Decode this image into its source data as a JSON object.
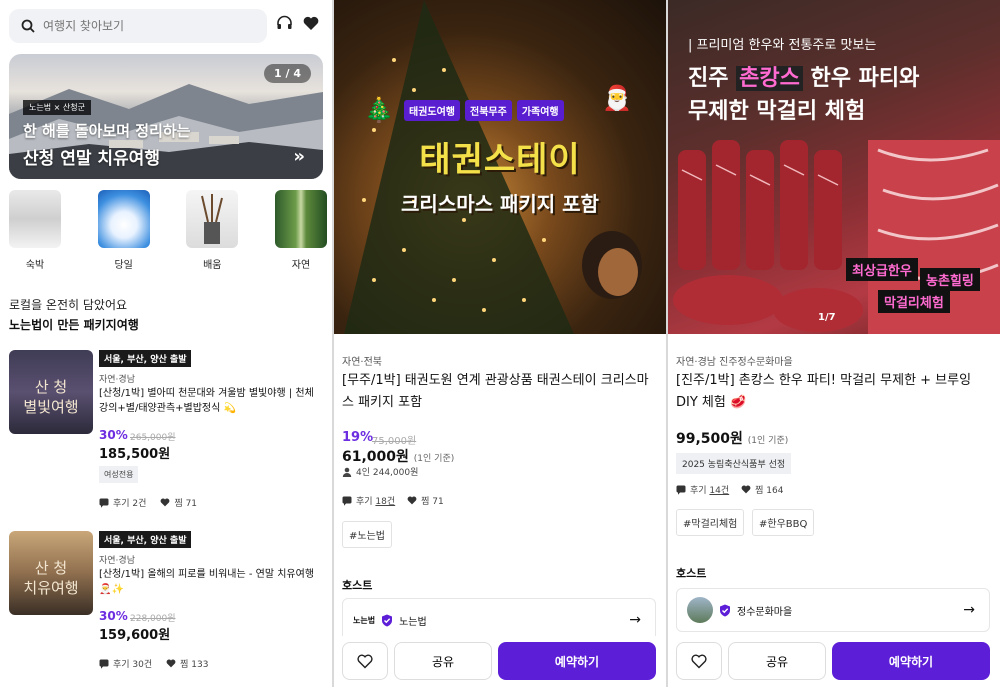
{
  "panel1": {
    "search_placeholder": "여행지 찾아보기",
    "banner": {
      "counter": "1 / 4",
      "tag": "노는법 × 산청군",
      "subtitle": "한 해를 돌아보며 정리하는",
      "title": "산청 연말 치유여행"
    },
    "categories": [
      {
        "label": "숙박"
      },
      {
        "label": "당일"
      },
      {
        "label": "배움"
      },
      {
        "label": "자연"
      }
    ],
    "section_line1": "로컬을 온전히 담았어요",
    "section_line2": "노는법이 만든 패키지여행",
    "cards": [
      {
        "image_text_1": "산 청",
        "image_text_2": "별빛여행",
        "badge": "서울, 부산, 양산 출발",
        "location": "자연·경남",
        "name": "[산청/1박] 별아띠 천문대와 겨울밤 별빛야행 | 천체강의+별/태양관측+별밥정식 💫",
        "discount": "30%",
        "original_price": "265,000원",
        "price": "185,500원",
        "chip": "여성전용",
        "reviews": "후기 2건",
        "likes": "찜 71"
      },
      {
        "image_text_1": "산 청",
        "image_text_2": "치유여행",
        "badge": "서울, 부산, 양산 출발",
        "location": "자연·경남",
        "name": "[산청/1박] 올해의 피로를 비워내는 - 연말 치유여행 🎅✨",
        "discount": "30%",
        "original_price": "228,000원",
        "price": "159,600원",
        "reviews": "후기 30건",
        "likes": "찜 133"
      }
    ]
  },
  "panel2": {
    "tags": [
      "태권도여행",
      "전북무주",
      "가족여행"
    ],
    "hero_title": "태권스테이",
    "hero_subtitle": "크리스마스 패키지 포함",
    "region": "자연·전북",
    "title": "[무주/1박] 태권도원 연계 관광상품 태권스테이 크리스마스 패키지 포함",
    "discount": "19%",
    "original_price": "75,000원",
    "price": "61,000원",
    "per": "(1인 기준)",
    "people_price": "4인 244,000원",
    "reviews_prefix": "후기 ",
    "reviews_count": "18건",
    "likes": "찜 71",
    "hashtag": "#노는법",
    "host_label": "호스트",
    "host_logo": "노는법",
    "host_name": "노는법",
    "share": "공유",
    "book": "예약하기"
  },
  "panel3": {
    "hero_top": "| 프리미엄 한우와 전통주로 맛보는",
    "hero_t1_pre": "진주 ",
    "hero_t1_hl": "촌캉스",
    "hero_t1_post": " 한우 파티와",
    "hero_t2": "무제한 막걸리 체험",
    "labels": [
      "최상급한우",
      "농촌힐링",
      "막걸리체험"
    ],
    "counter": "1/7",
    "region": "자연·경남 진주정수문화마을",
    "title": "[진주/1박] 촌캉스 한우 파티! 막걸리 무제한 + 브루잉 DIY 체험 🥩",
    "price": "99,500원",
    "per": "(1인 기준)",
    "award": "2025 농림축산식품부 선정",
    "reviews_prefix": "후기 ",
    "reviews_count": "14건",
    "likes": "찜 164",
    "hashtags": [
      "#막걸리체험",
      "#한우BBQ"
    ],
    "host_label": "호스트",
    "host_name": "정수문화마을",
    "share": "공유",
    "book": "예약하기"
  },
  "colors": {
    "accent": "#5d1ed7",
    "discount": "#6c2ee0",
    "highlight_pink": "#ff6bd0"
  }
}
